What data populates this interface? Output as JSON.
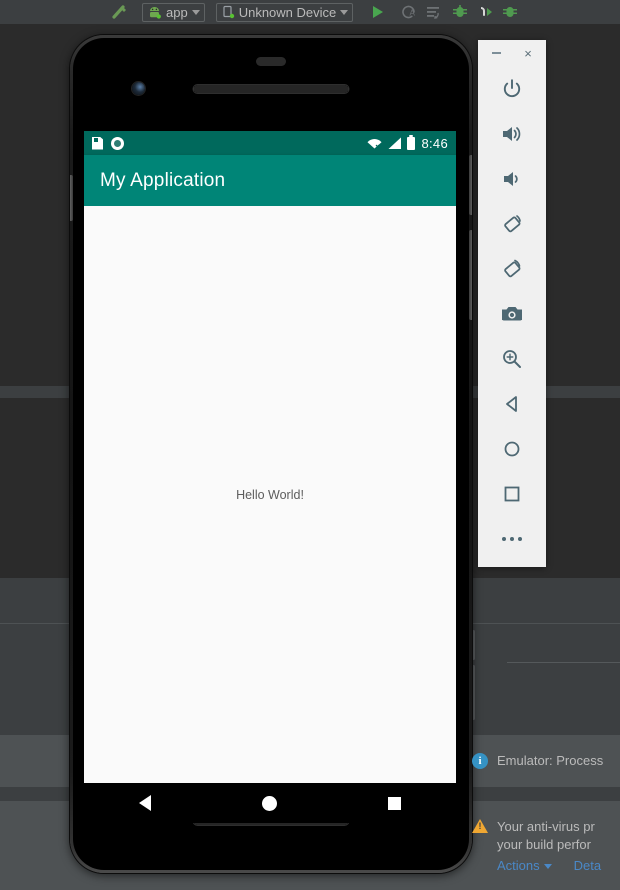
{
  "ide": {
    "toolbar": {
      "build_icon": "hammer-icon",
      "module_selector": {
        "label": "app",
        "icon": "android-robot-icon",
        "caret": "chevron-down-icon"
      },
      "device_selector": {
        "label": "Unknown Device",
        "icon": "device-icon",
        "caret": "chevron-down-icon"
      },
      "run_button": "run-icon",
      "apply_changes_button": "apply-changes-icon",
      "apply_code_changes_button": "apply-code-changes-icon",
      "debug_button": "debug-icon",
      "attach_debugger_button": "attach-debugger-icon",
      "profiler_button": "profiler-icon"
    }
  },
  "emulator": {
    "toolbar": {
      "minimize_label": "−",
      "close_label": "×",
      "buttons": [
        {
          "name": "power-icon",
          "label": "Power"
        },
        {
          "name": "volume-up-icon",
          "label": "Volume Up"
        },
        {
          "name": "volume-down-icon",
          "label": "Volume Down"
        },
        {
          "name": "rotate-left-icon",
          "label": "Rotate Left"
        },
        {
          "name": "rotate-right-icon",
          "label": "Rotate Right"
        },
        {
          "name": "camera-icon",
          "label": "Take Screenshot"
        },
        {
          "name": "zoom-in-icon",
          "label": "Zoom Mode"
        },
        {
          "name": "back-icon",
          "label": "Back"
        },
        {
          "name": "home-icon",
          "label": "Home"
        },
        {
          "name": "overview-icon",
          "label": "Overview"
        },
        {
          "name": "more-icon",
          "label": "More"
        }
      ]
    },
    "device": {
      "status_bar": {
        "clock": "8:46",
        "icons": [
          "sdcard-icon",
          "sync-circle-icon",
          "wifi-off-icon",
          "cellular-signal-icon",
          "battery-full-icon"
        ],
        "background": "#00695c"
      },
      "app_bar": {
        "title": "My Application",
        "background": "#008577"
      },
      "content": {
        "text": "Hello World!"
      },
      "nav_bar": {
        "back": "back-triangle-icon",
        "home": "home-circle-icon",
        "recents": "recents-square-icon"
      }
    }
  },
  "notifications": [
    {
      "severity": "info",
      "icon": "info-icon",
      "text": "Emulator: Process"
    },
    {
      "severity": "warning",
      "icon": "warning-icon",
      "line1": "Your anti-virus pr",
      "line2": "your build perfor",
      "actions_label": "Actions",
      "details_label": "Deta"
    }
  ],
  "colors": {
    "ide_background": "#3c3f41",
    "editor_background": "#2b2b2b",
    "accent_green": "#49a64f",
    "link_blue": "#4a88c7",
    "teal_primary": "#008577",
    "teal_dark": "#00695c"
  }
}
